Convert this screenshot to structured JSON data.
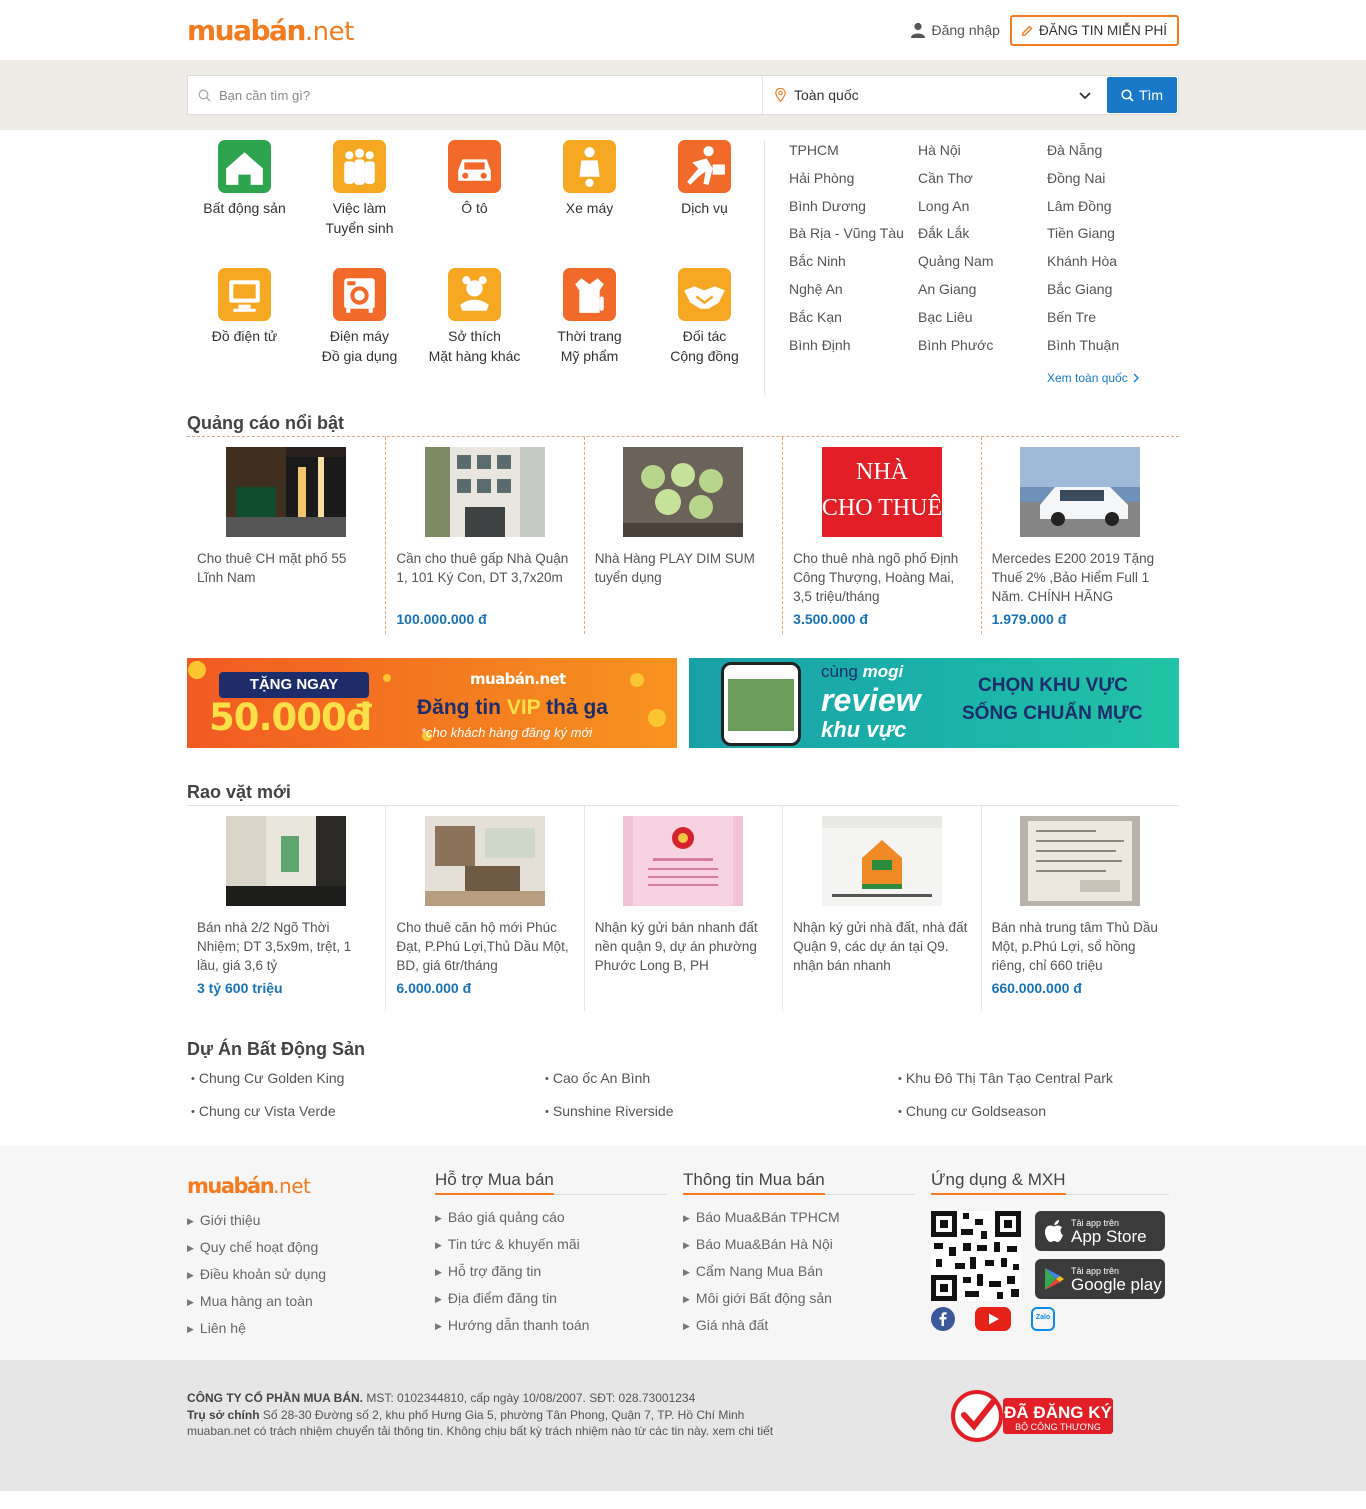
{
  "header": {
    "logo_main": "muabán",
    "logo_tld": ".net",
    "login_label": "Đăng nhập",
    "post_button_label": "ĐĂNG TIN MIỄN PHÍ"
  },
  "search": {
    "placeholder": "Bạn cần tìm gì?",
    "location_value": "Toàn quốc",
    "button_label": "Tìm"
  },
  "categories": [
    {
      "line1": "Bất động sản",
      "line2": "",
      "color": "#2ea44f",
      "icon": "house-icon"
    },
    {
      "line1": "Việc làm",
      "line2": "Tuyển sinh",
      "color": "#f7a823",
      "icon": "people-icon"
    },
    {
      "line1": "Ô tô",
      "line2": "",
      "color": "#f26a2a",
      "icon": "car-icon"
    },
    {
      "line1": "Xe máy",
      "line2": "",
      "color": "#f7a823",
      "icon": "scooter-icon"
    },
    {
      "line1": "Dịch vụ",
      "line2": "",
      "color": "#f26a2a",
      "icon": "service-icon"
    },
    {
      "line1": "Đồ điện tử",
      "line2": "",
      "color": "#f7a823",
      "icon": "computer-icon"
    },
    {
      "line1": "Điện máy",
      "line2": "Đồ gia dụng",
      "color": "#f26a2a",
      "icon": "appliance-icon"
    },
    {
      "line1": "Sở thích",
      "line2": "Mặt hàng khác",
      "color": "#f7a823",
      "icon": "toy-icon"
    },
    {
      "line1": "Thời trang",
      "line2": "Mỹ phẩm",
      "color": "#f26a2a",
      "icon": "fashion-icon"
    },
    {
      "line1": "Đối tác",
      "line2": "Cộng đồng",
      "color": "#f7a823",
      "icon": "handshake-icon"
    }
  ],
  "cities": [
    "TPHCM",
    "Hà Nội",
    "Đà Nẵng",
    "Hải Phòng",
    "Cần Thơ",
    "Đồng Nai",
    "Bình Dương",
    "Long An",
    "Lâm Đồng",
    "Bà Rịa - Vũng Tàu",
    "Đắk Lắk",
    "Tiền Giang",
    "Bắc Ninh",
    "Quảng Nam",
    "Khánh Hòa",
    "Nghệ An",
    "An Giang",
    "Bắc Giang",
    "Bắc Kạn",
    "Bạc Liêu",
    "Bến Tre",
    "Bình Định",
    "Bình Phước",
    "Bình Thuận"
  ],
  "cities_see_all": "Xem toàn quốc",
  "featured": {
    "title": "Quảng cáo nổi bật",
    "items": [
      {
        "title": "Cho thuê CH mặt phố 55 Lĩnh Nam",
        "price": ""
      },
      {
        "title": "Cần cho thuê gấp Nhà Quận 1, 101 Ký Con, DT 3,7x20m",
        "price": "100.000.000 đ"
      },
      {
        "title": "Nhà Hàng PLAY DIM SUM tuyển dụng",
        "price": ""
      },
      {
        "title": "Cho thuê nhà ngõ phố Định Công Thượng, Hoàng Mai, 3,5 triệu/tháng",
        "price": "3.500.000 đ"
      },
      {
        "title": "Mercedes E200 2019 Tặng Thuế 2% ,Bảo Hiểm Full 1 Năm. CHÍNH HÃNG",
        "price": "1.979.000 đ"
      }
    ],
    "thumb_sign_line1": "NHÀ",
    "thumb_sign_line2": "CHO THUÊ"
  },
  "banners": {
    "left": {
      "tag": "TẶNG NGAY",
      "amount": "50.000đ",
      "brand": "muabán.net",
      "headline_a": "Đăng tin ",
      "headline_vip": "VIP",
      "headline_b": " thả ga",
      "note": "*cho khách hàng đăng ký mới"
    },
    "right": {
      "prefix": "cùng",
      "brand": "mogi",
      "line1": "review",
      "line2": "khu vực",
      "slogan1": "CHỌN KHU VỰC",
      "slogan2": "SỐNG CHUẨN MỰC"
    }
  },
  "latest": {
    "title": "Rao vặt mới",
    "items": [
      {
        "title": "Bán nhà 2/2 Ngõ Thời Nhiệm; DT 3,5x9m, trệt, 1 lầu, giá 3,6 tỷ",
        "price": "3 tỷ 600 triệu"
      },
      {
        "title": "Cho thuê căn hộ mới Phúc Đạt, P.Phú Lợi,Thủ Dầu Một, BD, giá 6tr/tháng",
        "price": "6.000.000 đ"
      },
      {
        "title": "Nhận ký gửi bán nhanh đất nền quận 9, dự án phường Phước Long B, PH",
        "price": ""
      },
      {
        "title": "Nhận ký gửi nhà đất, nhà đất Quận 9, các dự án tại Q9. nhận bán nhanh",
        "price": ""
      },
      {
        "title": "Bán nhà trung tâm Thủ Dầu Một, p.Phú Lợi, sổ hồng riêng, chỉ 660 triệu",
        "price": "660.000.000 đ"
      }
    ]
  },
  "projects": {
    "title": "Dự Án Bất Động Sản",
    "items": [
      "Chung Cư Golden King",
      "Cao ốc An Bình",
      "Khu Đô Thị Tân Tạo Central Park",
      "Chung cư Vista Verde",
      "Sunshine Riverside",
      "Chung cư Goldseason"
    ]
  },
  "footer": {
    "about_links": [
      "Giới thiệu",
      "Quy chế hoạt động",
      "Điều khoản sử dụng",
      "Mua hàng an toàn",
      "Liên hệ"
    ],
    "support_title": "Hỗ trợ Mua bán",
    "support_links": [
      "Báo giá quảng cáo",
      "Tin tức & khuyến mãi",
      "Hỗ trợ đăng tin",
      "Địa điểm đăng tin",
      "Hướng dẫn thanh toán"
    ],
    "info_title": "Thông tin Mua bán",
    "info_links": [
      "Báo Mua&Bán TPHCM",
      "Báo Mua&Bán Hà Nội",
      "Cẩm Nang Mua Bán",
      "Môi giới Bất động sản",
      "Giá nhà đất"
    ],
    "apps_title": "Ứng dụng & MXH",
    "appstore_small": "Tải app trên",
    "appstore_big": "App Store",
    "gplay_small": "Tải app trên",
    "gplay_big": "Google play",
    "zalo_label": "Zalo"
  },
  "legal": {
    "company": "CÔNG TY CỔ PHẦN MUA BÁN.",
    "company_rest": " MST: 0102344810, cấp ngày 10/08/2007. SĐT: 028.73001234",
    "hq_label": "Trụ sở chính",
    "hq_rest": " Số 28-30 Đường số 2, khu phố Hưng Gia 5, phường Tân Phong, Quận 7, TP. Hồ Chí Minh",
    "disclaimer": "muaban.net có trách nhiệm chuyển tải thông tin. Không chịu bất kỳ trách nhiệm nào từ các tin này.",
    "more": " xem chi tiết",
    "badge_line1": "ĐÃ ĐĂNG KÝ",
    "badge_line2": "BỘ CÔNG THƯƠNG"
  },
  "colors": {
    "brand_orange": "#f47b20",
    "link_blue": "#1978c8",
    "price_blue": "#1a73b8",
    "band_bg": "#efebe6"
  }
}
